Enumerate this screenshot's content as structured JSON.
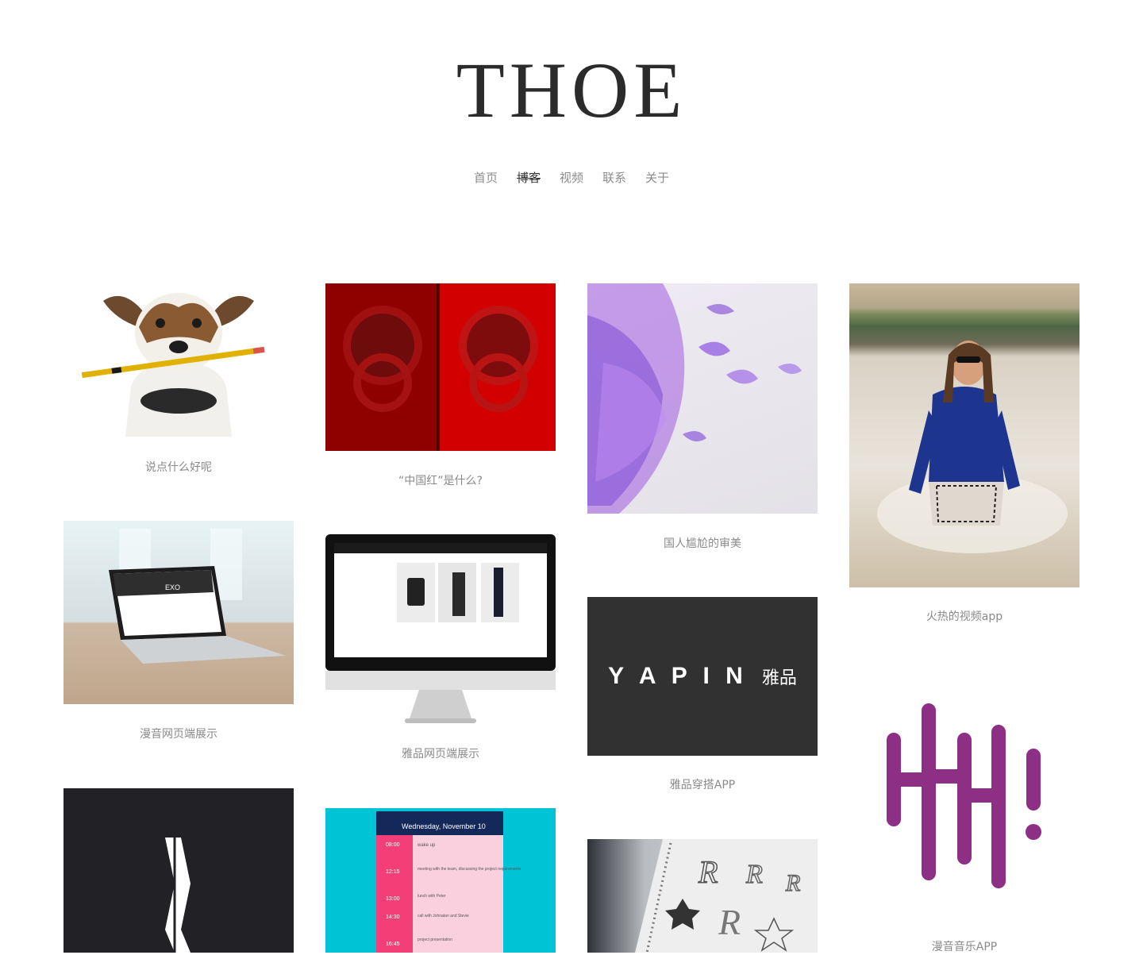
{
  "site": {
    "logo": "THOE"
  },
  "nav": [
    {
      "label": "首页"
    },
    {
      "label": "博客"
    },
    {
      "label": "视频"
    },
    {
      "label": "联系"
    },
    {
      "label": "关于"
    }
  ],
  "cards": [
    {
      "title": "说点什么好呢",
      "image": "dog-with-pencil"
    },
    {
      "title": "“中国红”是什么?",
      "image": "red-door-knockers"
    },
    {
      "title": "国人尴尬的审美",
      "image": "purple-petals"
    },
    {
      "title": "火热的视频app",
      "image": "woman-in-surf"
    },
    {
      "title": "漫音网页端展示",
      "image": "laptop-mockup",
      "screen_text": "EXO"
    },
    {
      "title": "雅品网页端展示",
      "image": "desktop-monitor-mockup"
    },
    {
      "title": "雅品穿搭APP",
      "image": "yapin-logo",
      "logo_latin": "Y A P I N",
      "logo_cn": "雅品"
    },
    {
      "title": "漫音音乐APP",
      "image": "sound-wave-logo"
    },
    {
      "title": "",
      "image": "letter-k-logo"
    },
    {
      "title": "",
      "image": "calendar-app-mockup",
      "app_header": "Wednesday, November 10",
      "events": [
        {
          "time": "08:00",
          "text": "wake up"
        },
        {
          "time": "12:15",
          "text": "meeting with the team, discussing the project requirements"
        },
        {
          "time": "13:00",
          "text": "lunch with Peter"
        },
        {
          "time": "14:30",
          "text": "call with Johnatan and Stevie"
        },
        {
          "time": "16:45",
          "text": "project presentation"
        }
      ]
    },
    {
      "title": "",
      "image": "sketchbook-letters"
    }
  ],
  "colors": {
    "yapin_bg": "#313131",
    "wave": "#8e2f86",
    "calendar_bg": "#00c4d6"
  }
}
